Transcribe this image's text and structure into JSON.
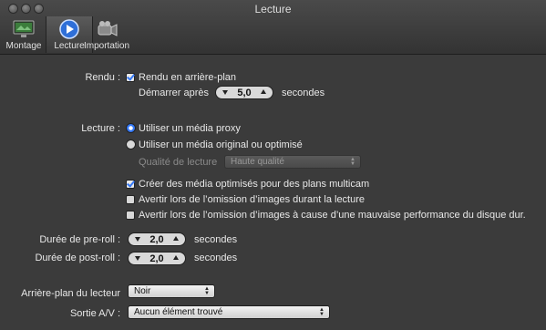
{
  "window": {
    "title": "Lecture"
  },
  "toolbar": {
    "items": [
      {
        "label": "Montage",
        "icon": "monitor-icon"
      },
      {
        "label": "Lecture",
        "icon": "play-icon"
      },
      {
        "label": "Importation",
        "icon": "camera-icon"
      }
    ]
  },
  "rendu": {
    "label": "Rendu :",
    "background_render": {
      "label": "Rendu en arrière-plan",
      "checked": true
    },
    "start_after": {
      "label": "Démarrer après",
      "value": "5,0",
      "unit": "secondes"
    }
  },
  "lecture": {
    "label": "Lecture :",
    "proxy": {
      "label": "Utiliser un média proxy",
      "selected": true
    },
    "original": {
      "label": "Utiliser un média original ou optimisé",
      "selected": false
    },
    "quality": {
      "label": "Qualité de lecture",
      "value": "Haute qualité"
    },
    "multicam": {
      "label": "Créer des média optimisés pour des plans multicam",
      "checked": true
    },
    "warn_drop": {
      "label": "Avertir lors de l’omission d’images durant la lecture",
      "checked": false
    },
    "warn_disk": {
      "label": "Avertir lors de l’omission d’images à cause d’une mauvaise performance du disque dur.",
      "checked": false
    }
  },
  "preroll": {
    "label": "Durée de pre-roll :",
    "value": "2,0",
    "unit": "secondes"
  },
  "postroll": {
    "label": "Durée de post-roll :",
    "value": "2,0",
    "unit": "secondes"
  },
  "player_bg": {
    "label": "Arrière-plan du lecteur",
    "value": "Noir"
  },
  "av_out": {
    "label": "Sortie A/V :",
    "value": "Aucun élément trouvé"
  },
  "colors": {
    "accent": "#3478f6",
    "background": "#3b3b3b"
  }
}
